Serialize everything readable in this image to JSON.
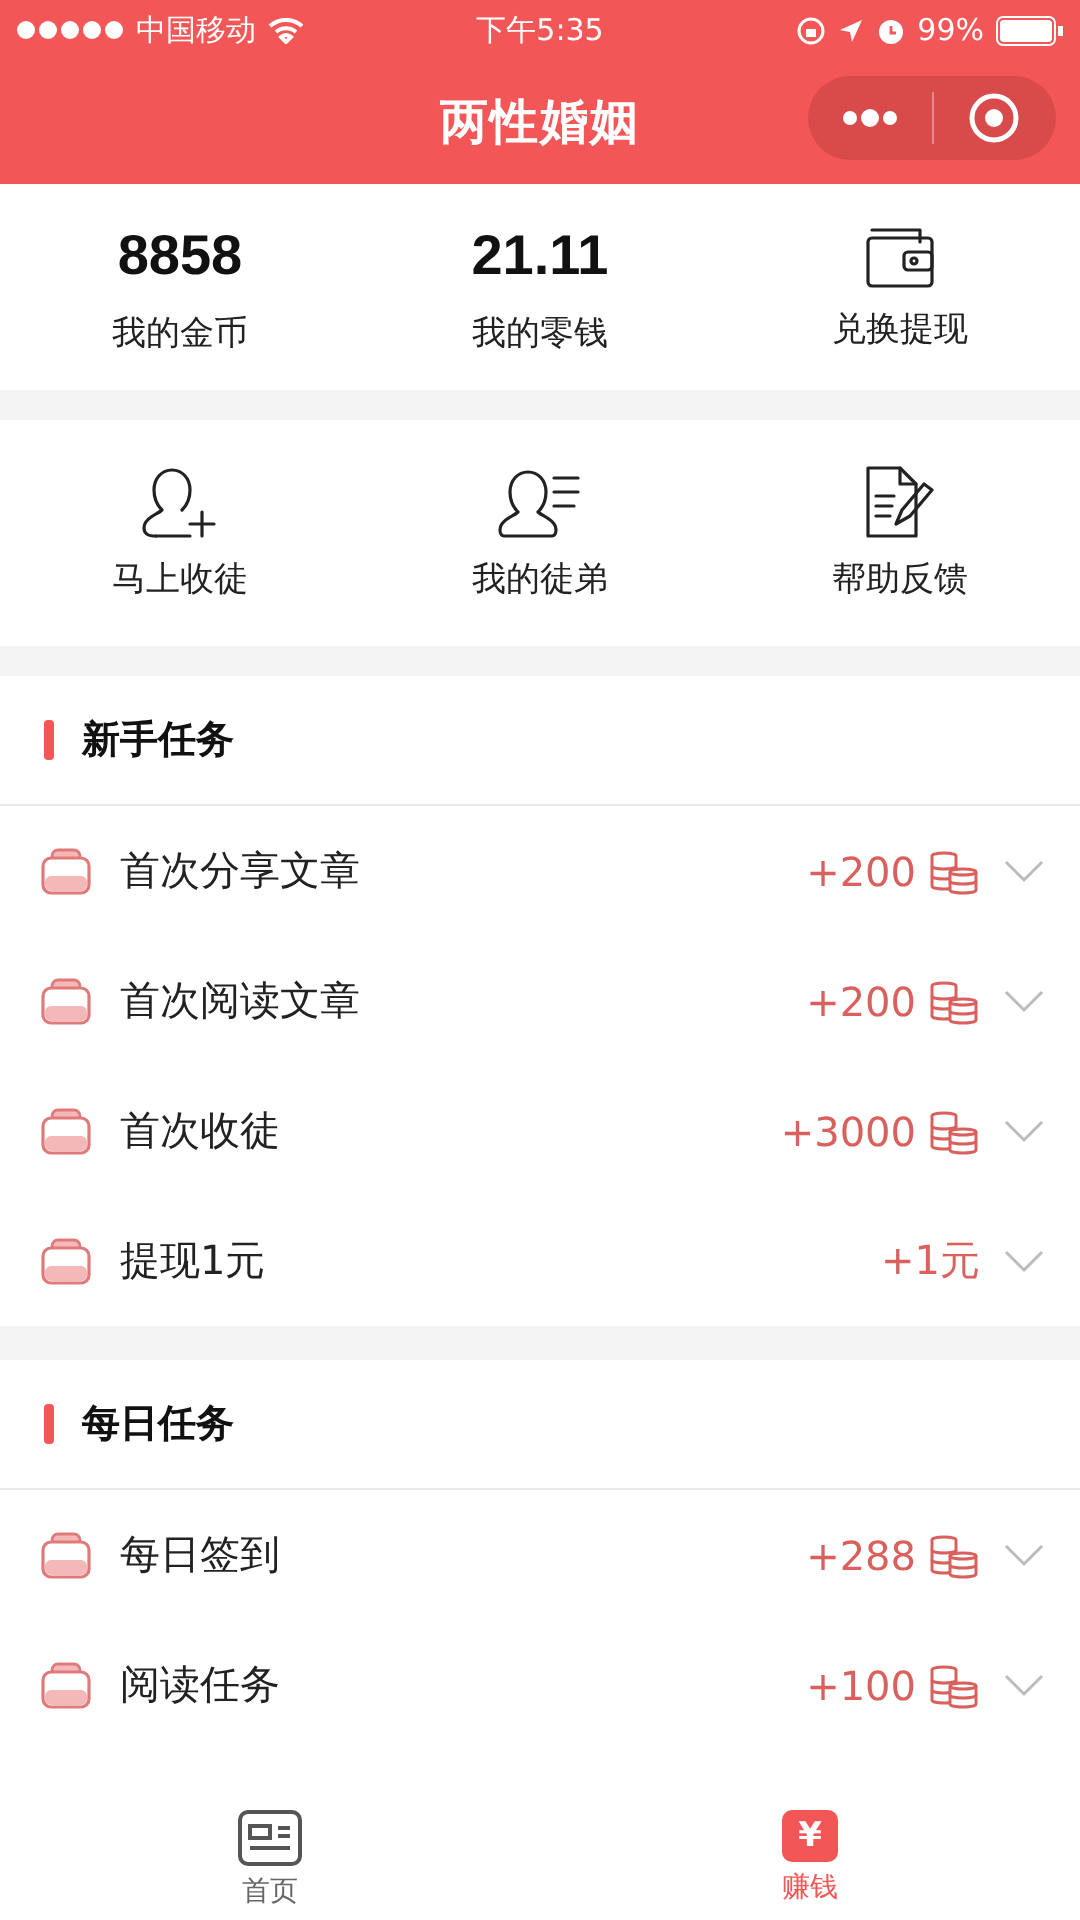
{
  "status_bar": {
    "carrier": "中国移动",
    "time": "下午5:35",
    "battery": "99%"
  },
  "nav": {
    "title": "两性婚姻"
  },
  "stats": [
    {
      "kind": "number",
      "value": "8858",
      "label": "我的金币"
    },
    {
      "kind": "number",
      "value": "21.11",
      "label": "我的零钱"
    },
    {
      "kind": "wallet",
      "label": "兑换提现"
    }
  ],
  "actions": [
    {
      "kind": "add-user",
      "label": "马上收徒"
    },
    {
      "kind": "user-list",
      "label": "我的徒弟"
    },
    {
      "kind": "document",
      "label": "帮助反馈"
    }
  ],
  "sections": [
    {
      "title": "新手任务",
      "tasks": [
        {
          "label": "首次分享文章",
          "reward": "+200",
          "kind": "coins"
        },
        {
          "label": "首次阅读文章",
          "reward": "+200",
          "kind": "coins"
        },
        {
          "label": "首次收徒",
          "reward": "+3000",
          "kind": "coins"
        },
        {
          "label": "提现1元",
          "reward": "+1元",
          "kind": "plain"
        }
      ]
    },
    {
      "title": "每日任务",
      "tasks": [
        {
          "label": "每日签到",
          "reward": "+288",
          "kind": "coins"
        },
        {
          "label": "阅读任务",
          "reward": "+100",
          "kind": "coins"
        }
      ]
    }
  ],
  "tab_bar": [
    {
      "kind": "news",
      "label": "首页",
      "selected": false
    },
    {
      "kind": "money",
      "icon": "¥",
      "label": "赚钱",
      "selected": true
    }
  ]
}
